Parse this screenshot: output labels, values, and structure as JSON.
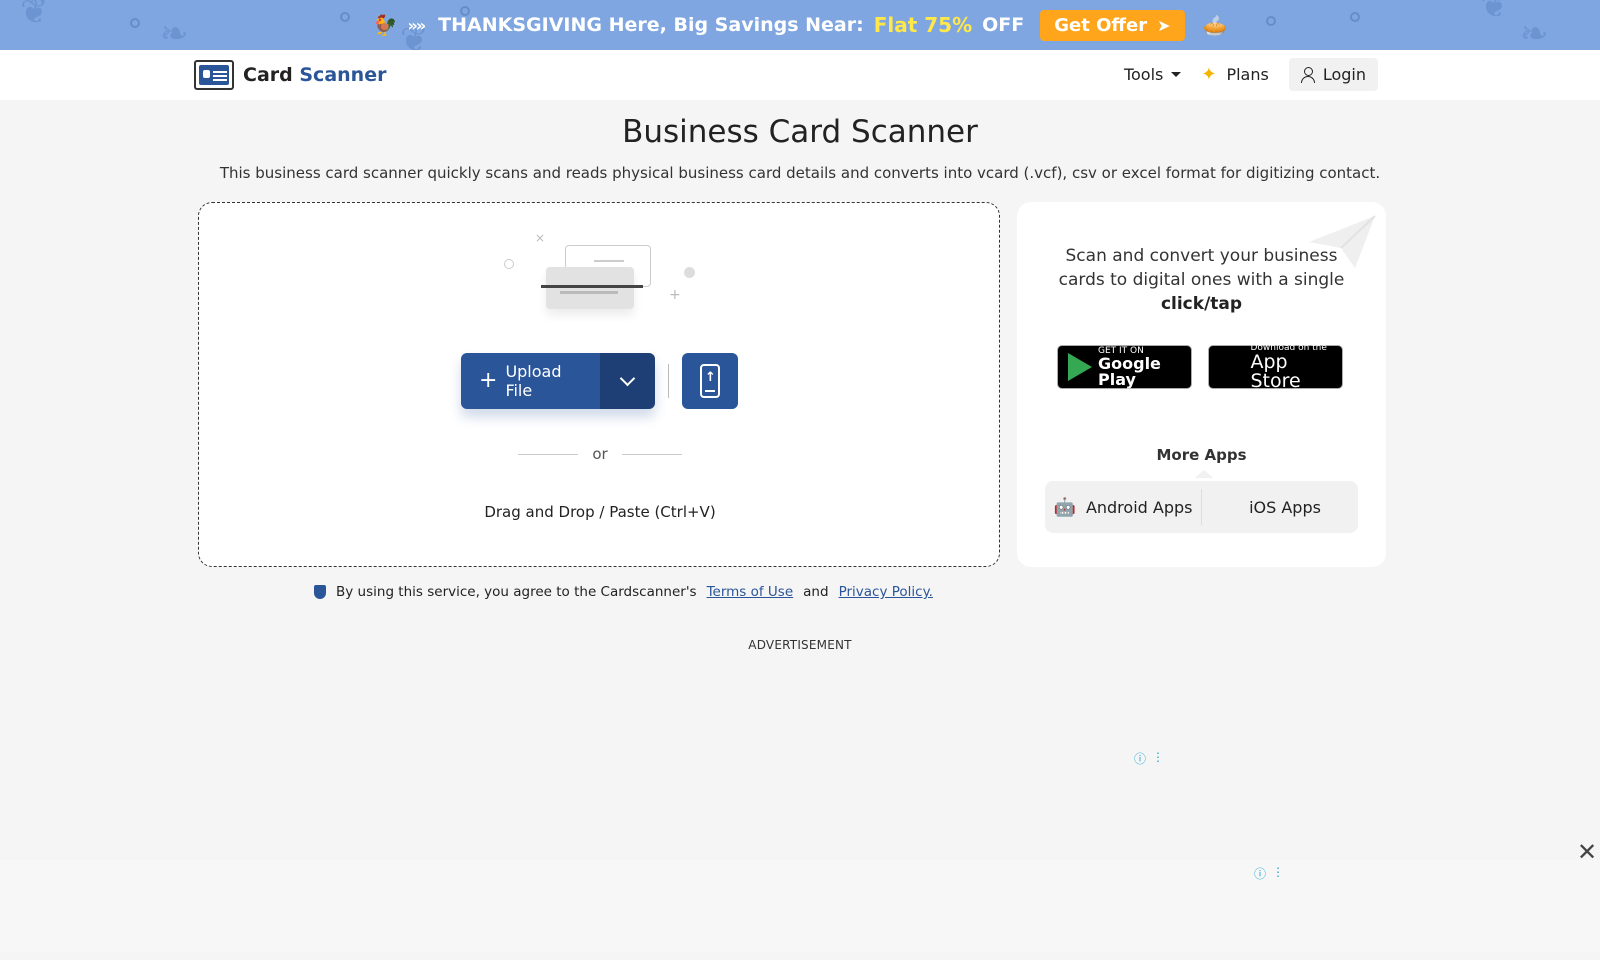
{
  "promo": {
    "emoji_left": "🐓",
    "arrows": "»»",
    "text": "THANKSGIVING Here, Big Savings Near:",
    "highlight": "Flat 75%",
    "off": "OFF",
    "cta": "Get Offer",
    "cta_arrow": "➤",
    "emoji_right": "🥧"
  },
  "nav": {
    "logo_word1": "Card",
    "logo_word2": "Scanner",
    "tools": "Tools",
    "plans": "Plans",
    "login": "Login"
  },
  "page": {
    "title": "Business Card Scanner",
    "subtitle": "This business card scanner quickly scans and reads physical business card details and converts into vcard (.vcf), csv or excel format for digitizing contact."
  },
  "upload": {
    "button_label": "Upload File",
    "or": "or",
    "drag_drop": "Drag and Drop / Paste (Ctrl+V)"
  },
  "side": {
    "text_lead": "Scan and convert your business cards to digital ones with a single",
    "text_bold": "click/tap",
    "google_small": "GET IT ON",
    "google_big": "Google Play",
    "apple_small": "Download on the",
    "apple_big": "App Store",
    "more_apps": "More Apps",
    "android_apps": "Android Apps",
    "ios_apps": "iOS Apps"
  },
  "terms": {
    "prefix": "By using this service, you agree to the Cardscanner's",
    "terms_link": "Terms of Use",
    "and": "and",
    "privacy_link": "Privacy Policy."
  },
  "ads": {
    "label": "ADVERTISEMENT",
    "info": "ⓘ",
    "menu": "⋮",
    "close": "✕"
  },
  "colors": {
    "brand": "#2a5599",
    "promo_bg": "#7fa6e0",
    "offer_btn": "#ffa51c",
    "promo_highlight": "#ffe84a"
  }
}
